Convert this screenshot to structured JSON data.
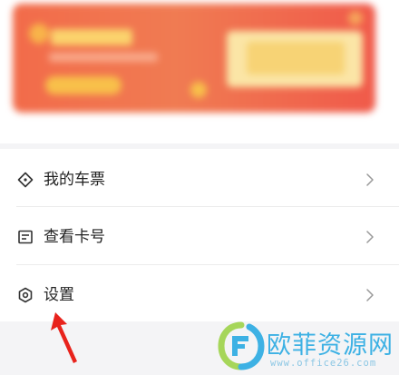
{
  "banner": {
    "colors": {
      "base": "#f26b4a",
      "accent": "#fbd36c"
    }
  },
  "menu": {
    "items": [
      {
        "label": "我的车票",
        "icon": "ticket-tag-icon"
      },
      {
        "label": "查看卡号",
        "icon": "card-number-icon"
      },
      {
        "label": "设置",
        "icon": "settings-hexagon-icon"
      }
    ],
    "chevron_icon": "chevron-right-icon"
  },
  "annotation": {
    "arrow_color": "#e8231c"
  },
  "watermark": {
    "name": "欧菲资源网",
    "url": "www.office26.com",
    "colors": {
      "text": "#3db1e4",
      "logo_green": "#a6d65a",
      "logo_blue": "#3db1e4"
    }
  }
}
